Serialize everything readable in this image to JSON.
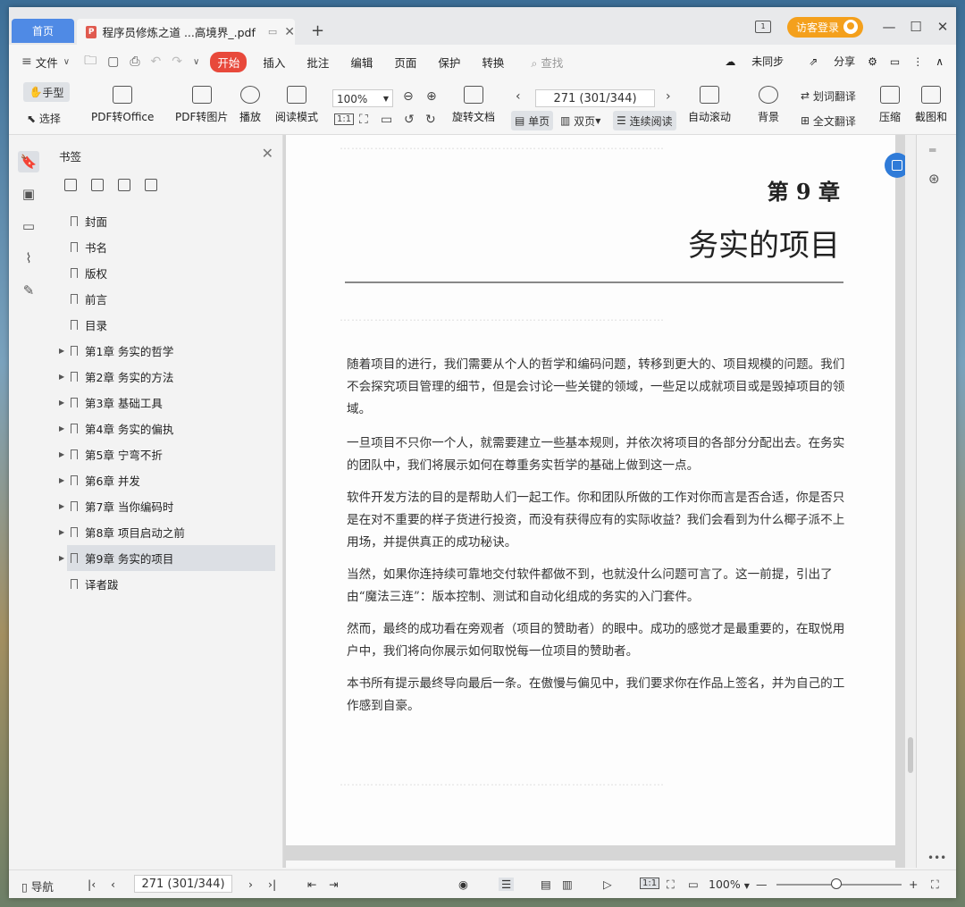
{
  "titlebar": {
    "home_tab": "首页",
    "doc_tab": "程序员修炼之道 ...高境界_.pdf",
    "add_tab": "+",
    "page_count_icon": "1",
    "login": "访客登录"
  },
  "menubar": {
    "file": "文件",
    "start": "开始",
    "items": [
      "插入",
      "批注",
      "编辑",
      "页面",
      "保护",
      "转换"
    ],
    "search": "查找",
    "sync": "未同步",
    "share": "分享"
  },
  "toolbar": {
    "hand": "手型",
    "select": "选择",
    "pdf_to_office": "PDF转Office",
    "pdf_to_image": "PDF转图片",
    "play": "播放",
    "read_mode": "阅读模式",
    "zoom": "100%",
    "rotate": "旋转文档",
    "page": "271 (301/344)",
    "single": "单页",
    "double": "双页",
    "continuous": "连续阅读",
    "auto_scroll": "自动滚动",
    "background": "背景",
    "word_translate": "划词翻译",
    "full_translate": "全文翻译",
    "compress": "压缩",
    "screenshot": "截图和"
  },
  "bookmarks": {
    "title": "书签",
    "items": [
      {
        "label": "封面",
        "expandable": false
      },
      {
        "label": "书名",
        "expandable": false
      },
      {
        "label": "版权",
        "expandable": false
      },
      {
        "label": "前言",
        "expandable": false
      },
      {
        "label": "目录",
        "expandable": false
      },
      {
        "label": "第1章  务实的哲学",
        "expandable": true
      },
      {
        "label": "第2章  务实的方法",
        "expandable": true
      },
      {
        "label": "第3章  基础工具",
        "expandable": true
      },
      {
        "label": "第4章  务实的偏执",
        "expandable": true
      },
      {
        "label": "第5章  宁弯不折",
        "expandable": true
      },
      {
        "label": "第6章  并发",
        "expandable": true
      },
      {
        "label": "第7章  当你编码时",
        "expandable": true
      },
      {
        "label": "第8章  项目启动之前",
        "expandable": true
      },
      {
        "label": "第9章  务实的项目",
        "expandable": true,
        "selected": true
      },
      {
        "label": "译者跋",
        "expandable": false
      }
    ]
  },
  "document": {
    "chapter_number": "第 9 章",
    "chapter_title": "务实的项目",
    "paragraphs": [
      "随着项目的进行，我们需要从个人的哲学和编码问题，转移到更大的、项目规模的问题。我们不会探究项目管理的细节，但是会讨论一些关键的领域，一些足以成就项目或是毁掉项目的领域。",
      "一旦项目不只你一个人，就需要建立一些基本规则，并依次将项目的各部分分配出去。在务实的团队中，我们将展示如何在尊重务实哲学的基础上做到这一点。",
      "软件开发方法的目的是帮助人们一起工作。你和团队所做的工作对你而言是否合适，你是否只是在对不重要的样子货进行投资，而没有获得应有的实际收益？我们会看到为什么椰子派不上用场，并提供真正的成功秘诀。",
      "当然，如果你连持续可靠地交付软件都做不到，也就没什么问题可言了。这一前提，引出了由“魔法三连”：版本控制、测试和自动化组成的务实的入门套件。",
      "然而，最终的成功看在旁观者（项目的赞助者）的眼中。成功的感觉才是最重要的，在取悦用户中，我们将向你展示如何取悦每一位项目的赞助者。",
      "本书所有提示最终导向最后一条。在傲慢与偏见中，我们要求你在作品上签名，并为自己的工作感到自豪。"
    ]
  },
  "statusbar": {
    "nav": "导航",
    "page": "271 (301/344)",
    "zoom": "100%"
  }
}
